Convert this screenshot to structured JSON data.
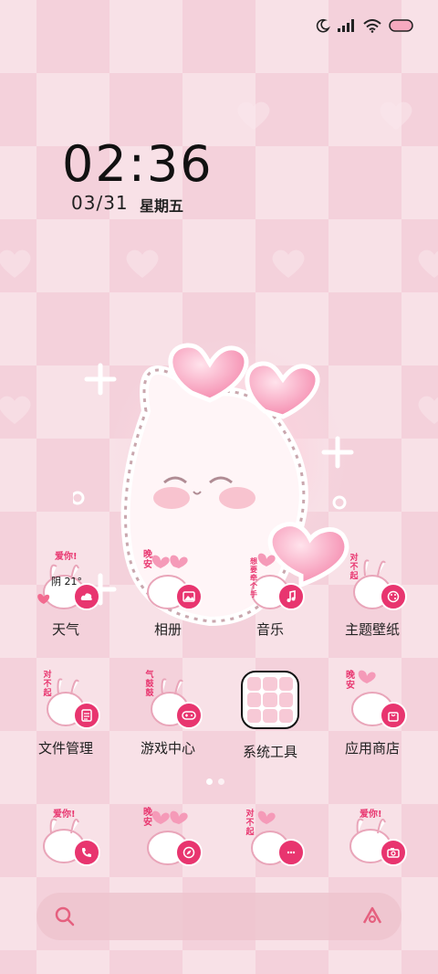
{
  "status": {
    "icons": [
      "moon-icon",
      "signal-icon",
      "wifi-icon",
      "battery-icon"
    ]
  },
  "clock": {
    "time": "02:36",
    "date": "03/31",
    "weekday": "星期五"
  },
  "weather_widget": {
    "temperature": "阴 21°"
  },
  "apps": [
    {
      "label": "天气",
      "badge": "cloud-icon",
      "sticker": "爱你!"
    },
    {
      "label": "相册",
      "badge": "image-icon",
      "sticker": "晚安"
    },
    {
      "label": "音乐",
      "badge": "music-note-icon",
      "sticker": "想要牵个手"
    },
    {
      "label": "主题壁纸",
      "badge": "palette-icon",
      "sticker": "对不起"
    },
    {
      "label": "文件管理",
      "badge": "document-icon",
      "sticker": "对不起"
    },
    {
      "label": "游戏中心",
      "badge": "gamepad-icon",
      "sticker": "气鼓鼓"
    },
    {
      "label": "系统工具",
      "badge": "folder-grid-icon",
      "sticker": ""
    },
    {
      "label": "应用商店",
      "badge": "shopping-bag-icon",
      "sticker": "晚安"
    }
  ],
  "dock": [
    {
      "badge": "phone-icon",
      "sticker": "爱你!"
    },
    {
      "badge": "compass-icon",
      "sticker": "晚安"
    },
    {
      "badge": "chat-icon",
      "sticker": "对不起"
    },
    {
      "badge": "camera-icon",
      "sticker": "爱你!"
    }
  ],
  "colors": {
    "accent": "#e8356f",
    "wallpaper_light": "#f9e2e8",
    "wallpaper_dark": "#f4d0da"
  }
}
